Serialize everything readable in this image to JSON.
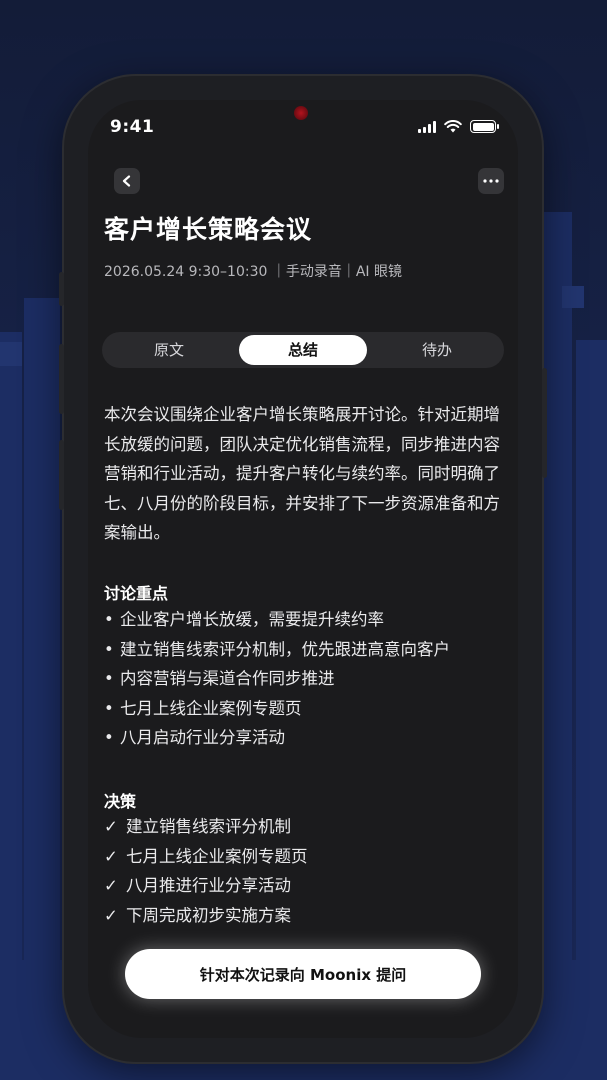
{
  "status_bar": {
    "time": "9:41"
  },
  "icons": {
    "back": "chevron-left-icon",
    "more": "more-horizontal-icon",
    "signal": "signal-icon",
    "wifi": "wifi-icon",
    "battery": "battery-icon"
  },
  "header": {
    "title": "客户增长策略会议",
    "meta": "2026.05.24 9:30–10:30 ｜手动录音｜AI 眼镜"
  },
  "tabs": [
    {
      "label": "原文",
      "active": false
    },
    {
      "label": "总结",
      "active": true
    },
    {
      "label": "待办",
      "active": false
    }
  ],
  "summary": {
    "paragraph": "本次会议围绕企业客户增长策略展开讨论。针对近期增长放缓的问题，团队决定优化销售流程，同步推进内容营销和行业活动，提升客户转化与续约率。同时明确了七、八月份的阶段目标，并安排了下一步资源准备和方案输出。"
  },
  "discussion": {
    "heading": "讨论重点",
    "bullet": "•",
    "items": [
      "企业客户增长放缓，需要提升续约率",
      "建立销售线索评分机制，优先跟进高意向客户",
      "内容营销与渠道合作同步推进",
      "七月上线企业案例专题页",
      "八月启动行业分享活动"
    ]
  },
  "decisions": {
    "heading": "决策",
    "check": "✓",
    "items": [
      "建立销售线索评分机制",
      "七月上线企业案例专题页",
      "八月推进行业分享活动",
      "下周完成初步实施方案"
    ]
  },
  "action": {
    "ask_label": "针对本次记录向 Moonix 提问"
  },
  "colors": {
    "background": "#17234a",
    "screen": "#1b1b1d",
    "accent": "#ffffff",
    "camera": "#b3141e"
  }
}
